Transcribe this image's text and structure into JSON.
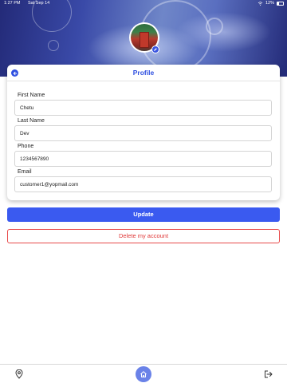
{
  "status_bar": {
    "time": "1:27 PM",
    "date": "Sat Sep 14",
    "battery": "12%"
  },
  "header": {
    "title": "Profile"
  },
  "form": {
    "first_name": {
      "label": "First Name",
      "value": "Chetu"
    },
    "last_name": {
      "label": "Last Name",
      "value": "Dev"
    },
    "phone": {
      "label": "Phone",
      "value": "1234567890"
    },
    "email": {
      "label": "Email",
      "value": "customer1@yopmail.com"
    }
  },
  "actions": {
    "update_label": "Update",
    "delete_label": "Delete my account"
  },
  "colors": {
    "accent": "#3a5af0",
    "danger": "#e03a3a",
    "title": "#2e4fe0",
    "home_bg": "#6a82e8"
  },
  "icons": {
    "back": "arrow-left-icon",
    "edit": "pencil-icon",
    "location": "map-pin-icon",
    "home": "home-icon",
    "logout": "logout-icon"
  }
}
